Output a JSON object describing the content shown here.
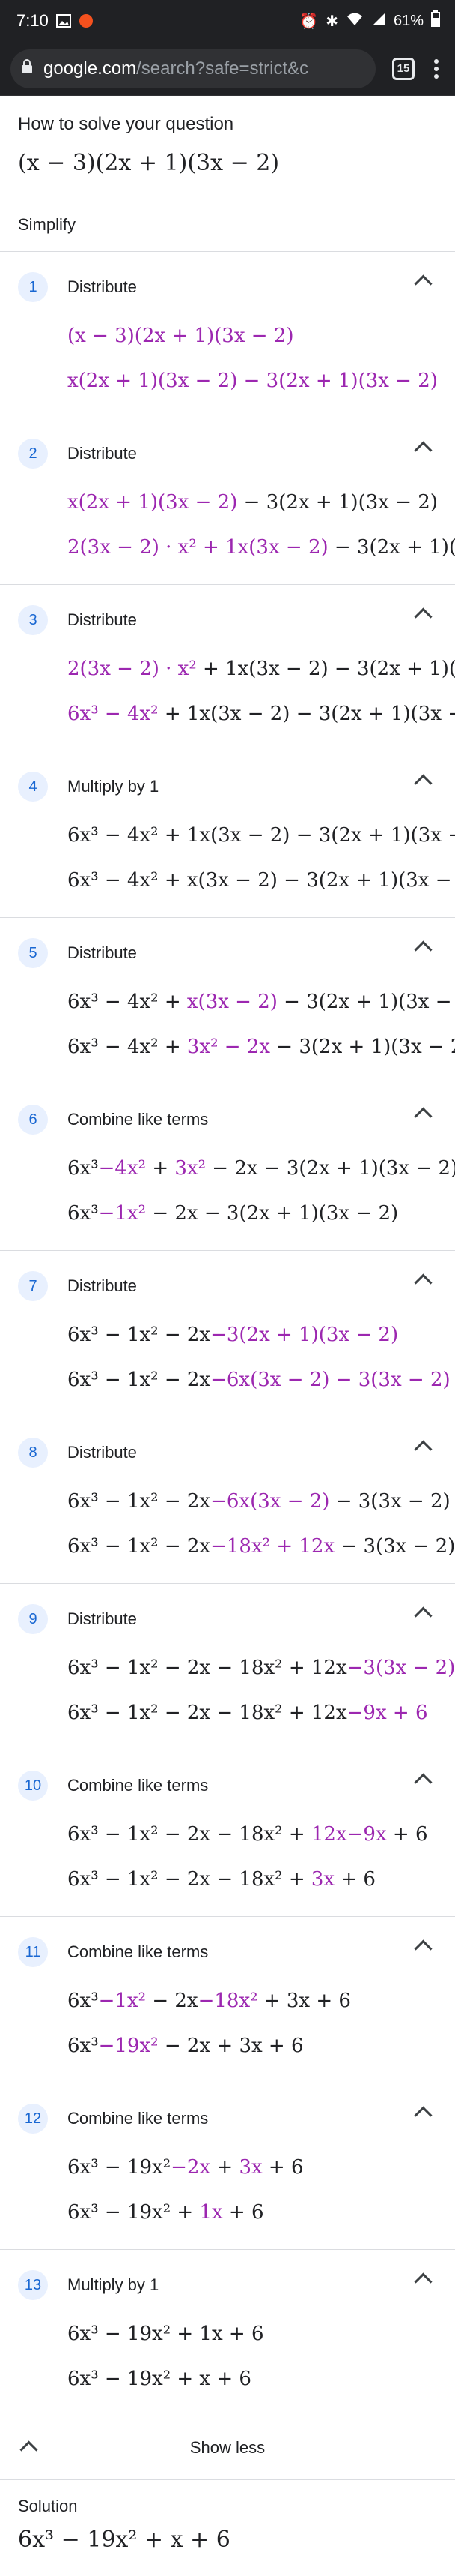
{
  "status": {
    "time": "7:10",
    "battery": "61%"
  },
  "browser": {
    "url_host": "google.com",
    "url_path": "/search?safe=strict&c",
    "tab_count": "15"
  },
  "header": {
    "question_label": "How to solve your question",
    "expression": "(x − 3)(2x + 1)(3x − 2)"
  },
  "simplify_label": "Simplify",
  "steps": [
    {
      "num": "1",
      "title": "Distribute"
    },
    {
      "num": "2",
      "title": "Distribute"
    },
    {
      "num": "3",
      "title": "Distribute"
    },
    {
      "num": "4",
      "title": "Multiply by 1"
    },
    {
      "num": "5",
      "title": "Distribute"
    },
    {
      "num": "6",
      "title": "Combine like terms"
    },
    {
      "num": "7",
      "title": "Distribute"
    },
    {
      "num": "8",
      "title": "Distribute"
    },
    {
      "num": "9",
      "title": "Distribute"
    },
    {
      "num": "10",
      "title": "Combine like terms"
    },
    {
      "num": "11",
      "title": "Combine like terms"
    },
    {
      "num": "12",
      "title": "Combine like terms"
    },
    {
      "num": "13",
      "title": "Multiply by 1"
    }
  ],
  "show_less_label": "Show less",
  "solution": {
    "label": "Solution",
    "expression": "6x³ − 19x² + x + 6"
  },
  "colors": {
    "accent": "#9c27b0",
    "badge_bg": "#e8f0fe",
    "badge_fg": "#1967d2"
  }
}
